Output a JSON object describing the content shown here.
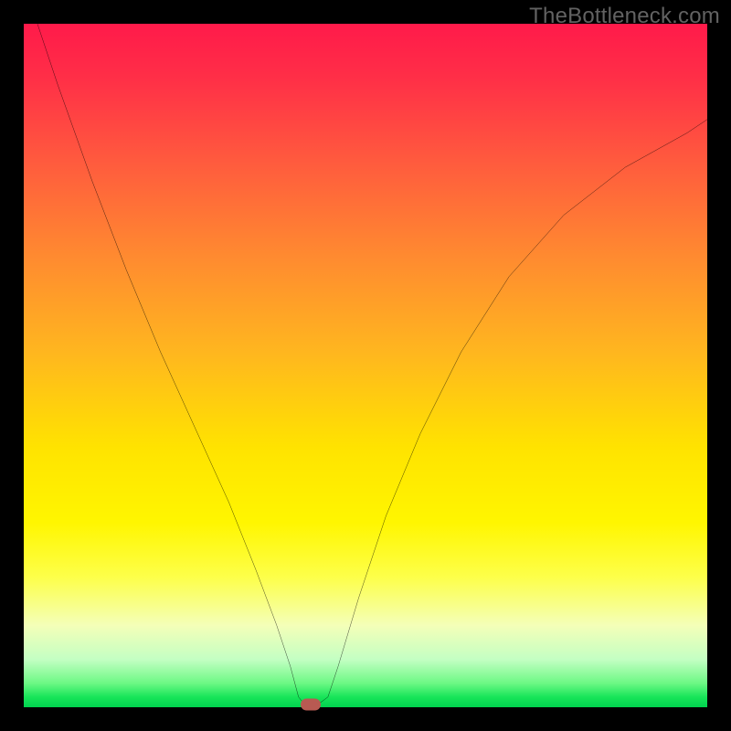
{
  "watermark": "TheBottleneck.com",
  "chart_data": {
    "type": "line",
    "title": "",
    "xlabel": "",
    "ylabel": "",
    "xlim": [
      0,
      100
    ],
    "ylim": [
      0,
      100
    ],
    "grid": false,
    "legend": false,
    "series": [
      {
        "name": "curve",
        "color": "#000000",
        "x": [
          2,
          5,
          10,
          15,
          20,
          25,
          30,
          34,
          37,
          39,
          40.2,
          41,
          42,
          43.3,
          44.5,
          46,
          49,
          53,
          58,
          64,
          71,
          79,
          88,
          97,
          100
        ],
        "y": [
          100,
          91,
          77,
          64,
          52,
          41,
          30,
          20,
          12,
          6,
          1.5,
          0.5,
          0.4,
          0.6,
          1.5,
          6,
          16,
          28,
          40,
          52,
          63,
          72,
          79,
          84,
          86
        ]
      }
    ],
    "marker": {
      "x": 42,
      "y": 0.4,
      "color": "#b85a52"
    },
    "background_gradient": {
      "direction": "vertical",
      "stops": [
        {
          "pos": 0.0,
          "color": "#ff1a4a"
        },
        {
          "pos": 0.34,
          "color": "#ff8a30"
        },
        {
          "pos": 0.62,
          "color": "#ffe300"
        },
        {
          "pos": 0.81,
          "color": "#fdff4a"
        },
        {
          "pos": 0.93,
          "color": "#c4ffc3"
        },
        {
          "pos": 1.0,
          "color": "#00d34f"
        }
      ]
    }
  }
}
